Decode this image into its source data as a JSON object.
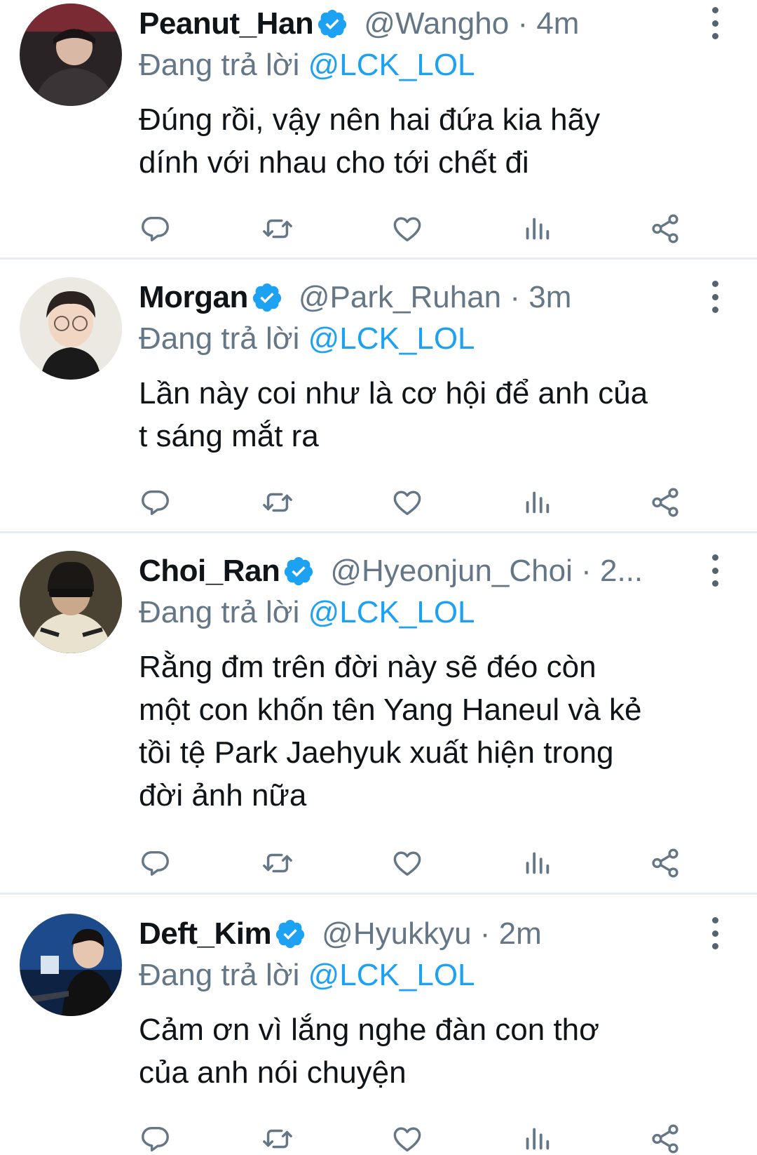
{
  "replying_prefix": "Đang trả lời",
  "accent_color": "#1da1f2",
  "tweets": [
    {
      "name": "Peanut_Han",
      "handle_time": "@Wangho · 4m",
      "reply_to": "@LCK_LOL",
      "lines": [
        "Đúng rồi, vậy nên hai đứa kia hãy",
        "dính với nhau cho tới chết đi"
      ]
    },
    {
      "name": "Morgan",
      "handle_time": "@Park_Ruhan · 3m",
      "reply_to": "@LCK_LOL",
      "lines": [
        "Lần này coi như là cơ hội để anh của",
        "t sáng mắt ra"
      ]
    },
    {
      "name": "Choi_Ran",
      "handle_time": "@Hyeonjun_Choi · 2...",
      "reply_to": "@LCK_LOL",
      "lines": [
        "Rằng đm trên đời này sẽ đéo còn",
        "một con khốn tên Yang Haneul và kẻ",
        "tồi tệ Park Jaehyuk xuất hiện trong",
        "đời ảnh nữa"
      ]
    },
    {
      "name": "Deft_Kim",
      "handle_time": "@Hyukkyu · 2m",
      "reply_to": "@LCK_LOL",
      "lines": [
        "Cảm ơn vì lắng nghe đàn con thơ",
        "của anh nói chuyện"
      ]
    }
  ]
}
